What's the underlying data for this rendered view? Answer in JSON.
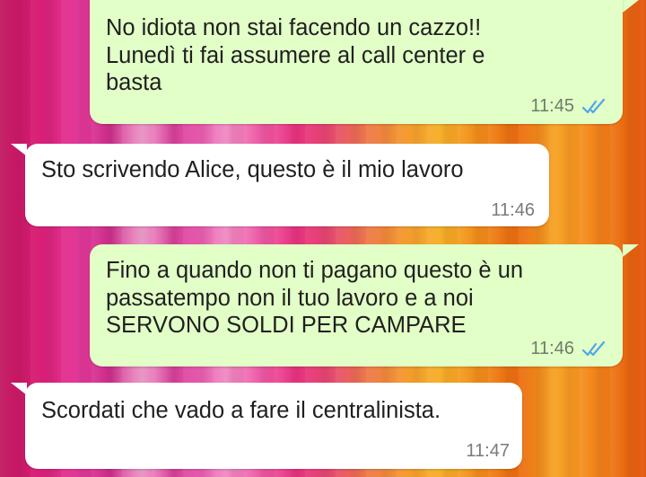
{
  "messages": [
    {
      "direction": "outgoing",
      "text": "No idiota non stai facendo un cazzo!!\nLunedì ti fai assumere al call center e\nbasta",
      "time": "11:45",
      "status": "read"
    },
    {
      "direction": "incoming",
      "text": "Sto scrivendo Alice, questo è il mio lavoro",
      "time": "11:46"
    },
    {
      "direction": "outgoing",
      "text": "Fino a quando non ti pagano questo è un\npassatempo non il tuo lavoro e a noi\nSERVONO SOLDI PER CAMPARE",
      "time": "11:46",
      "status": "read"
    },
    {
      "direction": "incoming",
      "text": "Scordati che vado a fare il centralinista.",
      "time": "11:47"
    }
  ],
  "colors": {
    "outgoing_bubble": "#e2ffc7",
    "incoming_bubble": "#ffffff",
    "read_ticks": "#4fa6e8"
  },
  "icons": {
    "read_receipt": "double-check-icon"
  }
}
